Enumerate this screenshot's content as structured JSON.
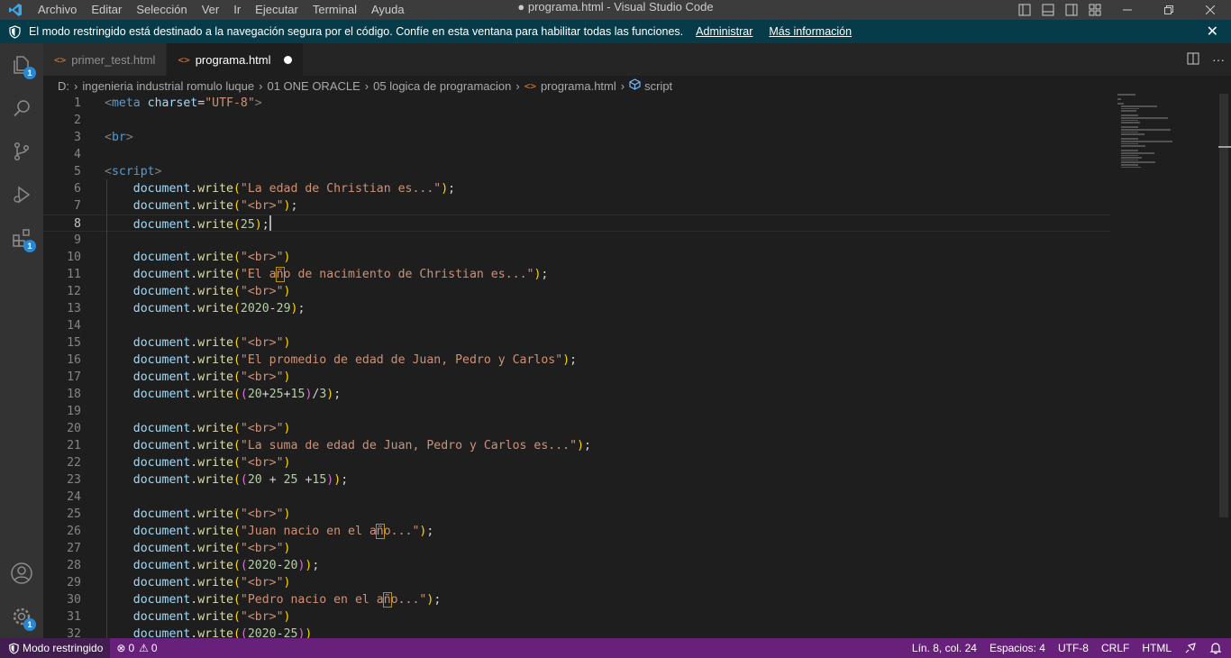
{
  "window": {
    "title": "● programa.html - Visual Studio Code",
    "menu": [
      "Archivo",
      "Editar",
      "Selección",
      "Ver",
      "Ir",
      "Ejecutar",
      "Terminal",
      "Ayuda"
    ]
  },
  "banner": {
    "message": "El modo restringido está destinado a la navegación segura por el código. Confíe en esta ventana para habilitar todas las funciones.",
    "manage_label": "Administrar",
    "more_info_label": "Más información"
  },
  "activity": {
    "explorer_badge": "1",
    "extensions_badge": "1",
    "settings_badge": "1"
  },
  "tabs": [
    {
      "label": "primer_test.html",
      "icon": "html-file-icon",
      "active": false
    },
    {
      "label": "programa.html",
      "icon": "html-file-icon",
      "active": true,
      "dirty": true
    }
  ],
  "breadcrumb": {
    "items": [
      "D:",
      "ingenieria industrial romulo luque",
      "01 ONE ORACLE",
      "05 logica de programacion",
      "programa.html",
      "script"
    ]
  },
  "editor": {
    "current_line": 8,
    "lines": [
      {
        "n": "1",
        "code": "<meta charset=\"UTF-8\">"
      },
      {
        "n": "2",
        "code": ""
      },
      {
        "n": "3",
        "code": "<br>"
      },
      {
        "n": "4",
        "code": ""
      },
      {
        "n": "5",
        "code": "<script>"
      },
      {
        "n": "6",
        "code": "    document.write(\"La edad de Christian es...\");"
      },
      {
        "n": "7",
        "code": "    document.write(\"<br>\");"
      },
      {
        "n": "8",
        "code": "    document.write(25);"
      },
      {
        "n": "9",
        "code": ""
      },
      {
        "n": "10",
        "code": "    document.write(\"<br>\")"
      },
      {
        "n": "11",
        "code": "    document.write(\"El año de nacimiento de Christian es...\");"
      },
      {
        "n": "12",
        "code": "    document.write(\"<br>\")"
      },
      {
        "n": "13",
        "code": "    document.write(2020-29);"
      },
      {
        "n": "14",
        "code": ""
      },
      {
        "n": "15",
        "code": "    document.write(\"<br>\")"
      },
      {
        "n": "16",
        "code": "    document.write(\"El promedio de edad de Juan, Pedro y Carlos\");"
      },
      {
        "n": "17",
        "code": "    document.write(\"<br>\")"
      },
      {
        "n": "18",
        "code": "    document.write((20+25+15)/3);"
      },
      {
        "n": "19",
        "code": ""
      },
      {
        "n": "20",
        "code": "    document.write(\"<br>\")"
      },
      {
        "n": "21",
        "code": "    document.write(\"La suma de edad de Juan, Pedro y Carlos es...\");"
      },
      {
        "n": "22",
        "code": "    document.write(\"<br>\")"
      },
      {
        "n": "23",
        "code": "    document.write((20 + 25 +15));"
      },
      {
        "n": "24",
        "code": ""
      },
      {
        "n": "25",
        "code": "    document.write(\"<br>\")"
      },
      {
        "n": "26",
        "code": "    document.write(\"Juan nacio en el año...\");"
      },
      {
        "n": "27",
        "code": "    document.write(\"<br>\")"
      },
      {
        "n": "28",
        "code": "    document.write((2020-20));"
      },
      {
        "n": "29",
        "code": "    document.write(\"<br>\")"
      },
      {
        "n": "30",
        "code": "    document.write(\"Pedro nacio en el año...\");"
      },
      {
        "n": "31",
        "code": "    document.write(\"<br>\")"
      },
      {
        "n": "32",
        "code": "    document.write((2020-25))"
      }
    ]
  },
  "status": {
    "restricted": "Modo restringido",
    "errors": "0",
    "warnings": "0",
    "position": "Lín. 8, col. 24",
    "spaces": "Espacios: 4",
    "encoding": "UTF-8",
    "eol": "CRLF",
    "language": "HTML"
  },
  "colors": {
    "status_bar": "#68217a",
    "banner": "#063b49",
    "activity_bar": "#333333"
  }
}
